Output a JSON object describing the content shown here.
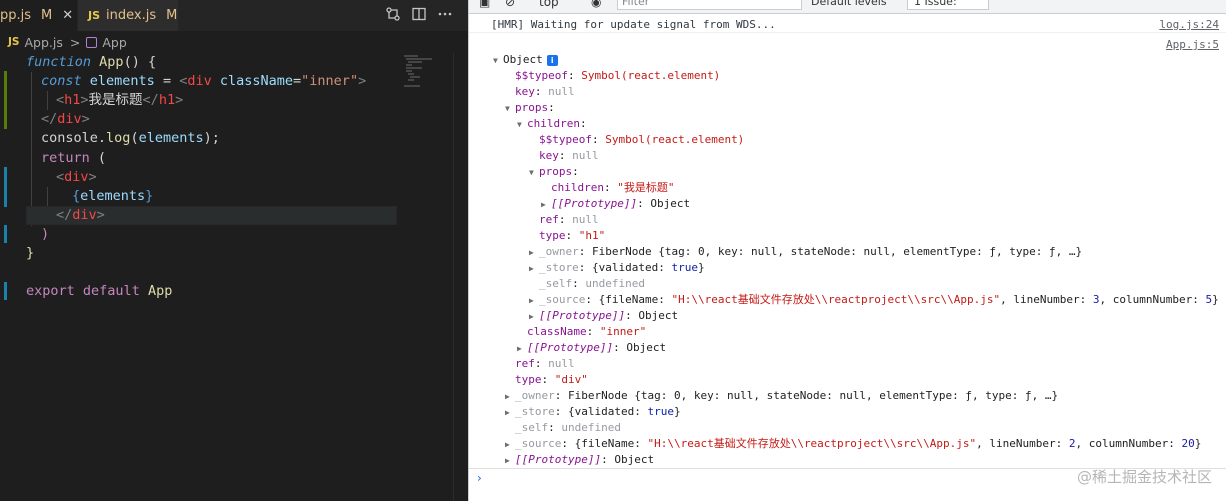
{
  "editor": {
    "tabs": [
      {
        "name": "pp.js",
        "status": "M",
        "close": "✕"
      },
      {
        "name": "index.js",
        "status": "M"
      }
    ],
    "js_label": "JS",
    "breadcrumb": {
      "file": "App.js",
      "separator": ">",
      "symbol": "App"
    },
    "code": {
      "l1": {
        "kw": "function",
        "fn": "App",
        "rest": "() {"
      },
      "l2": {
        "kw": "const",
        "var": "elements",
        "eq": " = ",
        "lt": "<",
        "tag": "div",
        "attr": "className",
        "eq2": "=",
        "val": "\"inner\"",
        "gt": ">"
      },
      "l3": {
        "lt": "<",
        "tag": "h1",
        "gt": ">",
        "text": "我是标题",
        "close_lt": "</",
        "close_tag": "h1",
        "close_gt": ">"
      },
      "l4": {
        "lt": "</",
        "tag": "div",
        "gt": ">"
      },
      "l5": {
        "obj": "console",
        "dot": ".",
        "method": "log",
        "open": "(",
        "arg": "elements",
        "close": ");"
      },
      "l6": {
        "kw": "return",
        "rest": " ("
      },
      "l7": {
        "lt": "<",
        "tag": "div",
        "gt": ">"
      },
      "l8": {
        "open": "{",
        "var": "elements",
        "close": "}"
      },
      "l9": {
        "lt": "</",
        "tag": "div",
        "gt": ">"
      },
      "l10": {
        "text": ")"
      },
      "l11": {
        "text": "}"
      },
      "l13": {
        "kw1": "export",
        "kw2": "default",
        "name": "App"
      }
    }
  },
  "devtools": {
    "toolbar": {
      "context": "top",
      "filter_placeholder": "Filter",
      "levels": "Default levels",
      "issues": "1 Issue:"
    },
    "hmr": {
      "text": "[HMR] Waiting for update signal from WDS...",
      "source": "log.js:24"
    },
    "log_source": "App.js:5",
    "tree": {
      "object": "Object",
      "info": "i",
      "typeof_key": "$$typeof",
      "typeof_val": "Symbol(react.element)",
      "key_key": "key",
      "null": "null",
      "props_key": "props",
      "children_key": "children",
      "children_text": "\"我是标题\"",
      "prototype_key": "[[Prototype]]",
      "ref_key": "ref",
      "type_key": "type",
      "type_h1": "\"h1\"",
      "type_div": "\"div\"",
      "owner_key": "_owner",
      "owner_val": "FiberNode {tag: 0, key: null, stateNode: null, elementType: ƒ, type: ƒ, …}",
      "store_key": "_store",
      "store_val_a": "{validated: ",
      "store_val_b": "true",
      "store_val_c": "}",
      "self_key": "_self",
      "undefined": "undefined",
      "source_key": "_source",
      "source1_a": "{fileName: ",
      "source1_b": "\"H:\\\\react基础文件存放处\\\\reactproject\\\\src\\\\App.js\"",
      "source1_c": ", lineNumber: ",
      "source1_d": "3",
      "source1_e": ", columnNumber: ",
      "source1_f": "5",
      "source1_g": "}",
      "source2_d": "2",
      "source2_f": "20",
      "classname_key": "className",
      "classname_val": "\"inner\""
    },
    "prompt_caret": "›",
    "watermark": "@稀土掘金技术社区"
  }
}
